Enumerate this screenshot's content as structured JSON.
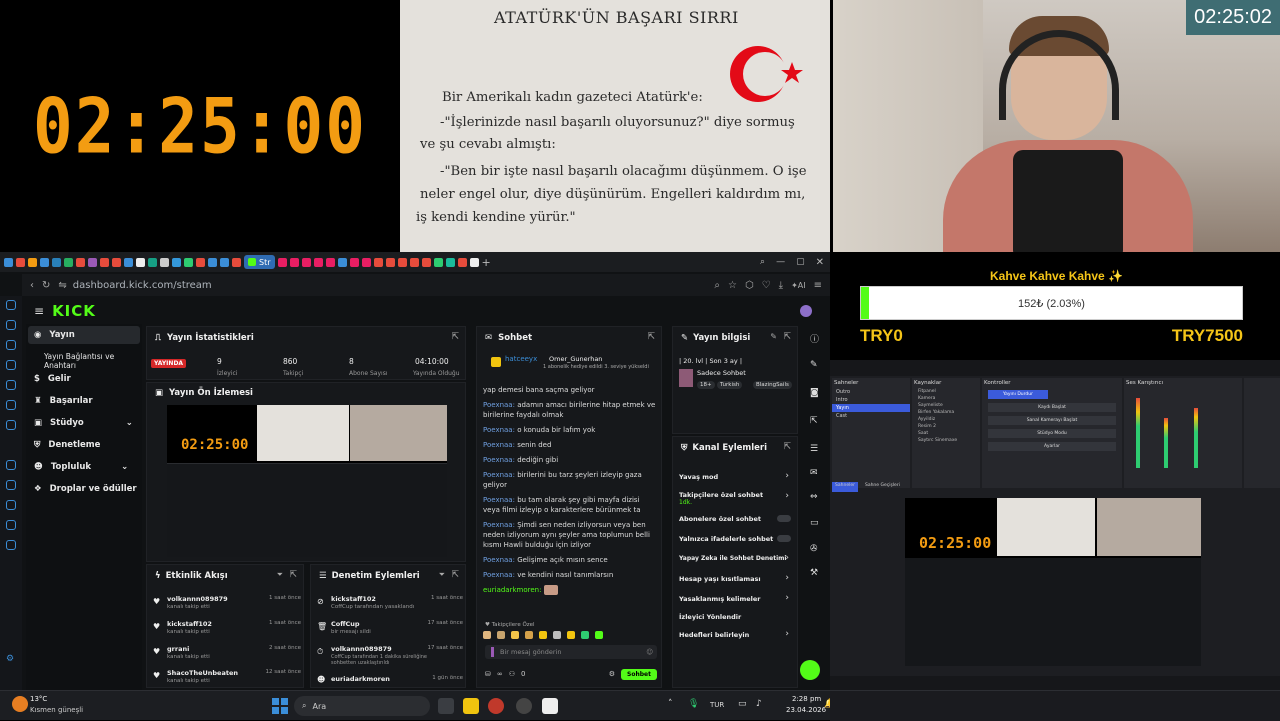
{
  "timer_large": "02:25:00",
  "cam_clock": "02:25:02",
  "book": {
    "title": "ATATÜRK'ÜN BAŞARI SIRRI",
    "lines": [
      "Bir Amerikalı kadın gazeteci Atatürk'e:",
      "-\"İşlerinizde nasıl başarılı oluyorsunuz?\" diye sormuş",
      "ve şu cevabı almıştı:",
      "-\"Ben bir işte nasıl başarılı olacağımı düşünmem. O işe",
      "neler engel olur, diye düşünürüm. Engelleri kaldırdım mı,",
      "iş kendi kendine yürür.\""
    ]
  },
  "browser": {
    "url": "dashboard.kick.com/stream",
    "active_tab": "Str",
    "logo": "KICK",
    "nav": [
      "Yayın",
      "Yayın Bağlantısı ve Anahtarı",
      "Gelir",
      "Başarılar",
      "Stüdyo",
      "Denetleme",
      "Topluluk",
      "Droplar ve ödüller"
    ]
  },
  "stats": {
    "title": "Yayın İstatistikleri",
    "live_badge": "YAYINDA",
    "values": [
      "9",
      "860",
      "8",
      "04:10:00"
    ],
    "labels": [
      "İzleyici",
      "Takipçi",
      "Abone Sayısı",
      "Yayında Olduğu"
    ]
  },
  "preview": {
    "title": "Yayın Ön İzlemesi",
    "timer": "02:25:00"
  },
  "chat": {
    "title": "Sohbet",
    "pinned_user": "hatceeyx",
    "pinned_top": "Omer_Gunerhan",
    "pinned_note": "1 abonelik hediye edildi 3. seviye yükseldi",
    "messages": [
      {
        "user": "",
        "text": "yap demesi bana saçma geliyor"
      },
      {
        "user": "Poexnaa:",
        "text": "adamın amacı birilerine hitap etmek ve birilerine faydalı olmak"
      },
      {
        "user": "Poexnaa:",
        "text": "o konuda bir lafım yok"
      },
      {
        "user": "Poexnaa:",
        "text": "senin ded"
      },
      {
        "user": "Poexnaa:",
        "text": "dediğin gibi"
      },
      {
        "user": "Poexnaa:",
        "text": "birilerini bu tarz şeyleri izleyip gaza geliyor"
      },
      {
        "user": "Poexnaa:",
        "text": "bu tam olarak şey gibi mayfa dizisi veya filmi izleyip o karakterlere bürünmek ta"
      },
      {
        "user": "Poexnaa:",
        "text": "Şimdi sen neden izliyorsun veya ben neden izliyorum aynı şeyler ama toplumun belli kısmı Hawli bulduğu için izliyor"
      },
      {
        "user": "Poexnaa:",
        "text": "Gelişime açık mısın sence"
      },
      {
        "user": "Poexnaa:",
        "text": "ve kendini nasıl tanımlarsın"
      },
      {
        "user": "euriadarkmoren:",
        "text": ""
      }
    ],
    "followers_only": "Takipçilere Özel",
    "input_placeholder": "Bir mesaj gönderin",
    "send": "Sohbet",
    "count_a": "∞",
    "count_b": "0"
  },
  "stream_info": {
    "title": "Yayın bilgisi",
    "line1": "| 20. lvl | Son 3 ay |",
    "category": "Sadece Sohbet",
    "tags": [
      "18+",
      "Turkish",
      "BlazingSails"
    ]
  },
  "channel_actions": {
    "title": "Kanal Eylemleri",
    "items": [
      "Yavaş mod",
      "Takipçilere özel sohbet",
      "Abonelere özel sohbet",
      "Yalnızca ifadelerle sohbet",
      "Yapay Zeka ile Sohbet Denetimi",
      "Hesap yaşı kısıtlaması",
      "Yasaklanmış kelimeler",
      "İzleyici Yönlendir",
      "Hedefleri belirleyin"
    ],
    "sub_1dk": "1dk."
  },
  "activity": {
    "title": "Etkinlik Akışı",
    "rows": [
      {
        "name": "volkannn089879",
        "sub": "kanalı takip etti",
        "time": "1 saat önce"
      },
      {
        "name": "kickstaff102",
        "sub": "kanalı takip etti",
        "time": "1 saat önce"
      },
      {
        "name": "grrani",
        "sub": "kanalı takip etti",
        "time": "2 saat önce"
      },
      {
        "name": "ShacoTheUnbeaten",
        "sub": "kanalı takip etti",
        "time": "12 saat önce"
      }
    ]
  },
  "moderation": {
    "title": "Denetim Eylemleri",
    "rows": [
      {
        "name": "kickstaff102",
        "sub": "CoffCup tarafından yasaklandı",
        "time": "1 saat önce"
      },
      {
        "name": "CoffCup",
        "sub": "bir mesajı sildi",
        "time": "17 saat önce"
      },
      {
        "name": "volkannn089879",
        "sub": "CoffCup tarafından 1 dakika süreliğine sohbetten uzaklaştırıldı",
        "time": "17 saat önce"
      },
      {
        "name": "euriadarkmoren",
        "sub": "",
        "time": "1 gün önce"
      }
    ]
  },
  "donate": {
    "title": "Kahve Kahve Kahve ✨",
    "progress_text": "152₺ (2.03%)",
    "progress": 0.0203,
    "min": "TRY0",
    "max": "TRY7500"
  },
  "obs": {
    "scenes_title": "Sahneler",
    "scenes": [
      "Outro",
      "Intro",
      "Yayın",
      "Cast"
    ],
    "sources_title": "Kaynaklar",
    "sources": [
      "Fitpanel",
      "Kamera",
      "Saymeliste",
      "Birfen Yakalama",
      "Ayyildiz",
      "Resim 2",
      "Saat",
      "Saytırc Sinemaxe"
    ],
    "controls_title": "Kontroller",
    "controls": [
      "Yayını Durdur",
      "Kaydı Başlat",
      "Sanal Kamerayı Başlat",
      "Stüdyo Modu",
      "Ayarlar"
    ],
    "mixer_title": "Ses Karıştırıcı",
    "timer": "02:25:00",
    "tab_scenes": "Sahneler",
    "tab_transitions": "Sahne Geçişleri"
  },
  "taskbar": {
    "weather_temp": "13°C",
    "weather_desc": "Kısmen güneşli",
    "search": "Ara",
    "lang": "TUR",
    "time": "2:28 pm",
    "date": "23.04.2026"
  },
  "colors": {
    "accent": "#53fc18",
    "timer": "#f39c12",
    "link": "#3b8ed8"
  }
}
